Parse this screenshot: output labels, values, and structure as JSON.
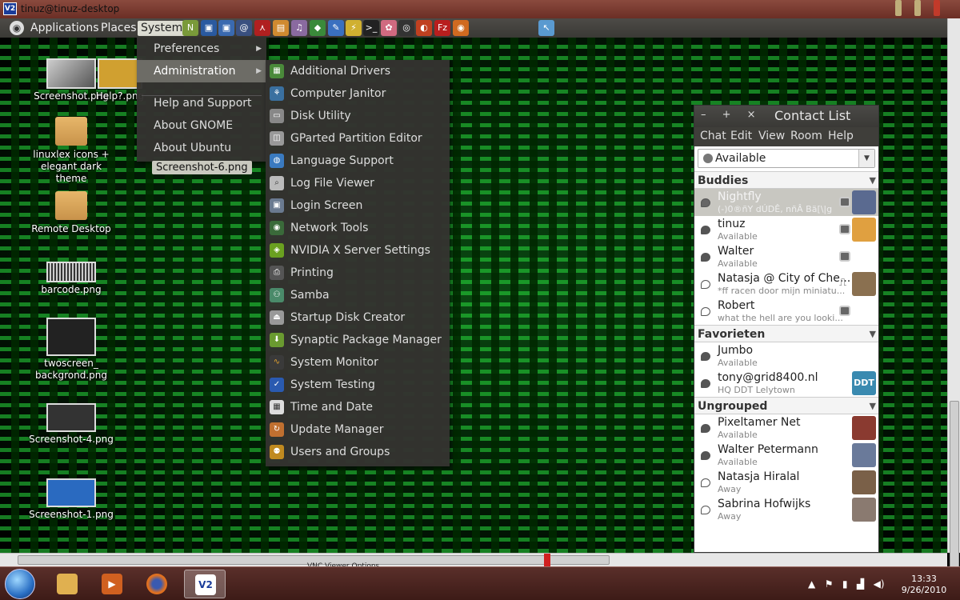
{
  "window": {
    "title": "tinuz@tinuz-desktop",
    "icon_label": "V2"
  },
  "gnome_panel": {
    "menus": [
      "Applications",
      "Places",
      "System"
    ]
  },
  "system_menu": {
    "items": [
      {
        "label": "Preferences",
        "has_submenu": true
      },
      {
        "label": "Administration",
        "has_submenu": true
      },
      {
        "label": "Help and Support"
      },
      {
        "label": "About GNOME"
      },
      {
        "label": "About Ubuntu"
      }
    ],
    "tooltip": "Screenshot-6.png"
  },
  "admin_menu": {
    "items": [
      {
        "label": "Additional Drivers",
        "icon": "chip-icon"
      },
      {
        "label": "Computer Janitor",
        "icon": "janitor-icon"
      },
      {
        "label": "Disk Utility",
        "icon": "disk-icon"
      },
      {
        "label": "GParted Partition Editor",
        "icon": "partition-icon"
      },
      {
        "label": "Language Support",
        "icon": "globe-icon"
      },
      {
        "label": "Log File Viewer",
        "icon": "log-icon"
      },
      {
        "label": "Login Screen",
        "icon": "login-icon"
      },
      {
        "label": "Network Tools",
        "icon": "network-icon"
      },
      {
        "label": "NVIDIA X Server Settings",
        "icon": "nvidia-icon"
      },
      {
        "label": "Printing",
        "icon": "printer-icon"
      },
      {
        "label": "Samba",
        "icon": "samba-icon"
      },
      {
        "label": "Startup Disk Creator",
        "icon": "usb-icon"
      },
      {
        "label": "Synaptic Package Manager",
        "icon": "package-icon"
      },
      {
        "label": "System Monitor",
        "icon": "monitor-icon"
      },
      {
        "label": "System Testing",
        "icon": "checkbox-icon"
      },
      {
        "label": "Time and Date",
        "icon": "calendar-icon"
      },
      {
        "label": "Update Manager",
        "icon": "update-icon"
      },
      {
        "label": "Users and Groups",
        "icon": "users-icon"
      }
    ]
  },
  "desktop_icons": [
    {
      "label": "Screenshot.png"
    },
    {
      "label": "Help?.png"
    },
    {
      "label": "linuxlex icons + elegant dark theme"
    },
    {
      "label": "Remote Desktop"
    },
    {
      "label": "barcode.png"
    },
    {
      "label": "twoscreen_ backgrond.png"
    },
    {
      "label": "Screenshot-4.png"
    },
    {
      "label": "Screenshot-1.png"
    }
  ],
  "contact_list": {
    "title": "Contact List",
    "title_buttons": "– + ×",
    "menus": [
      "Chat",
      "Edit",
      "View",
      "Room",
      "Help"
    ],
    "status": "Available",
    "groups": [
      {
        "name": "Buddies",
        "buddies": [
          {
            "name": "Nightfly",
            "status": "(-)0®ñY dÚDÊ, nñÂ Bä[\\|g",
            "bubble": "#666666",
            "extra": "camera-icon",
            "avatar": "#5a6a90",
            "highlight": true
          },
          {
            "name": "tinuz",
            "status": "Available",
            "bubble": "#555555",
            "extra": "camera-icon",
            "avatar": "#e0a040"
          },
          {
            "name": "Walter",
            "status": "Available",
            "bubble": "#555555",
            "extra": "camera-icon",
            "avatar": ""
          },
          {
            "name": "Natasja @ City of Che...",
            "status": "*ff racen door mijn miniatu...",
            "bubble": "#ffffff",
            "extra": "microphone-icon",
            "avatar": "#8a7050"
          },
          {
            "name": "Robert",
            "status": "what the hell are you looki...",
            "bubble": "#ffffff",
            "extra": "camera-icon",
            "avatar": ""
          }
        ]
      },
      {
        "name": "Favorieten",
        "buddies": [
          {
            "name": "Jumbo",
            "status": "Available",
            "bubble": "#555555",
            "extra": "",
            "avatar": ""
          },
          {
            "name": "tony@grid8400.nl",
            "status": "HQ DDT Lelytown",
            "bubble": "#555555",
            "extra": "",
            "avatar": "#3a8ab0",
            "avatar_text": "DDT"
          }
        ]
      },
      {
        "name": "Ungrouped",
        "buddies": [
          {
            "name": "Pixeltamer Net",
            "status": "Available",
            "bubble": "#555555",
            "extra": "",
            "avatar": "#8a3a30"
          },
          {
            "name": "Walter Petermann",
            "status": "Available",
            "bubble": "#555555",
            "extra": "",
            "avatar": "#6a7a9a"
          },
          {
            "name": "Natasja Hiralal",
            "status": "Away",
            "bubble": "#ffffff",
            "extra": "",
            "avatar": "#7a6048"
          },
          {
            "name": "Sabrina Hofwijks",
            "status": "Away",
            "bubble": "#ffffff",
            "extra": "",
            "avatar": "#8a7a70"
          }
        ]
      }
    ]
  },
  "scrollbar": {
    "vnc_label": "VNC Viewer Options"
  },
  "taskbar": {
    "pinned": [
      {
        "name": "explorer",
        "icon": "folder-icon"
      },
      {
        "name": "media player",
        "icon": "play-icon"
      },
      {
        "name": "firefox",
        "icon": "firefox-icon"
      },
      {
        "name": "vnc viewer",
        "icon": "vnc-icon",
        "label": "V2",
        "active": true
      }
    ],
    "clock_time": "13:33",
    "clock_date": "9/26/2010"
  },
  "colors": {
    "panel": "#3f3e3a",
    "menu_bg": "#343330",
    "highlight": "#6d6c66",
    "taskbar": "#4a2520"
  }
}
